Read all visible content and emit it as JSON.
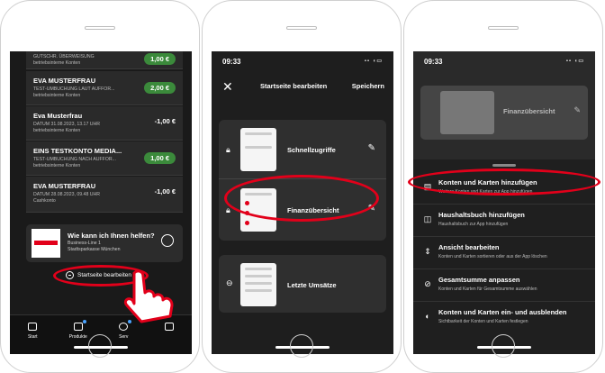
{
  "phone1": {
    "transactions": [
      {
        "name": "",
        "sub": "GUTSCHR. ÜBERWEISUNG\nbetriebsinterne Konten",
        "amount": "1,00 €",
        "positive": true
      },
      {
        "name": "EVA MUSTERFRAU",
        "sub": "TEST-UMBUCHUNG LAUT AUFFOR...\nbetriebsinterne Konten",
        "amount": "2,00 €",
        "positive": true
      },
      {
        "name": "Eva Musterfrau",
        "sub": "DATUM 31.08.2023, 13.17 UHR\nbetriebsinterne Konten",
        "amount": "-1,00 €",
        "positive": false
      },
      {
        "name": "EINS TESTKONTO MEDIA...",
        "sub": "TEST-UMBUCHUNG NACH AUFFOR...\nbetriebsinterne Konten",
        "amount": "1,00 €",
        "positive": true
      },
      {
        "name": "EVA MUSTERFRAU",
        "sub": "DATUM 28.08.2023, 09.48 UHR\nCashkonto",
        "amount": "-1,00 €",
        "positive": false
      }
    ],
    "help_title": "Wie kann ich Ihnen helfen?",
    "help_line1": "Business-Line 1",
    "help_line2": "Stadtsparkasse München",
    "edit_link": "Startseite bearbeiten",
    "tabs": [
      "Start",
      "Produkte",
      "Serv"
    ]
  },
  "phone2": {
    "time": "09:33",
    "title": "Startseite bearbeiten",
    "save": "Speichern",
    "widgets": [
      "Schnellzugriffe",
      "Finanzübersicht",
      "Letzte Umsätze"
    ]
  },
  "phone3": {
    "time": "09:33",
    "card_label": "Finanzübersicht",
    "options": [
      {
        "title": "Konten und Karten hinzufügen",
        "sub": "Weitere Konten und Karten zur App hinzufügen",
        "icon": "card-add-icon"
      },
      {
        "title": "Haushaltsbuch hinzufügen",
        "sub": "Haushaltsbuch zur App hinzufügen",
        "icon": "book-icon"
      },
      {
        "title": "Ansicht bearbeiten",
        "sub": "Konten und Karten sortieren oder aus der App löschen",
        "icon": "sort-icon"
      },
      {
        "title": "Gesamtsumme anpassen",
        "sub": "Konten und Karten für Gesamtsumme auswählen",
        "icon": "eye-off-icon"
      },
      {
        "title": "Konten und Karten ein- und ausblenden",
        "sub": "Sichtbarkeit der Konten und Karten festlegen",
        "icon": "toggle-icon"
      }
    ]
  },
  "colors": {
    "accent_red": "#e2001a",
    "positive_green": "#3b8a3b",
    "dark_bg": "#1a1a1a"
  }
}
